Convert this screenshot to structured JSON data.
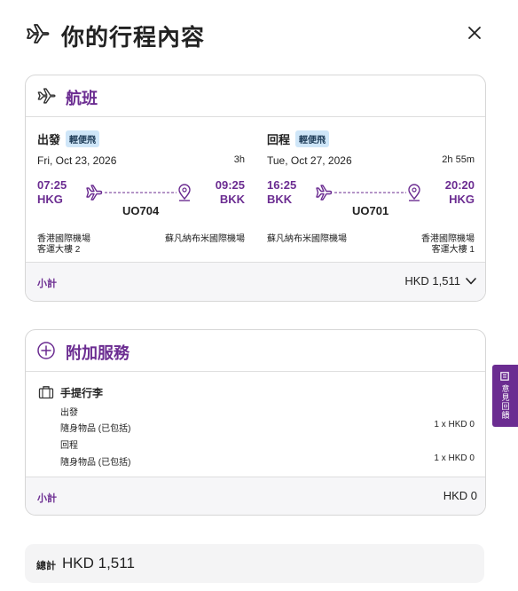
{
  "header": {
    "title": "你的行程內容"
  },
  "flight_section": {
    "title": "航班",
    "legs": [
      {
        "direction": "出發",
        "badge": "輕便飛",
        "date": "Fri, Oct 23, 2026",
        "duration": "3h",
        "dep_time": "07:25",
        "dep_code": "HKG",
        "arr_time": "09:25",
        "arr_code": "BKK",
        "flight_no": "UO704",
        "dep_airport": "香港國際機場",
        "dep_terminal": "客運大樓 2",
        "arr_airport": "蘇凡納布米國際機場",
        "arr_terminal": ""
      },
      {
        "direction": "回程",
        "badge": "輕便飛",
        "date": "Tue, Oct 27, 2026",
        "duration": "2h 55m",
        "dep_time": "16:25",
        "dep_code": "BKK",
        "arr_time": "20:20",
        "arr_code": "HKG",
        "flight_no": "UO701",
        "dep_airport": "蘇凡納布米國際機場",
        "dep_terminal": "",
        "arr_airport": "香港國際機場",
        "arr_terminal": "客運大樓 1"
      }
    ],
    "subtotal_label": "小計",
    "subtotal_amount": "HKD 1,511"
  },
  "addon_section": {
    "title": "附加服務",
    "baggage_title": "手提行李",
    "items": [
      {
        "direction": "出發",
        "desc": "隨身物品 (已包括)",
        "qty": "1 x HKD 0"
      },
      {
        "direction": "回程",
        "desc": "隨身物品 (已包括)",
        "qty": "1 x HKD 0"
      }
    ],
    "subtotal_label": "小計",
    "subtotal_amount": "HKD 0"
  },
  "total": {
    "label": "總計",
    "amount": "HKD 1,511"
  },
  "feedback": {
    "label": "意見回饋"
  },
  "colors": {
    "accent": "#6b2c91",
    "badge_bg": "#cfe6f8"
  }
}
